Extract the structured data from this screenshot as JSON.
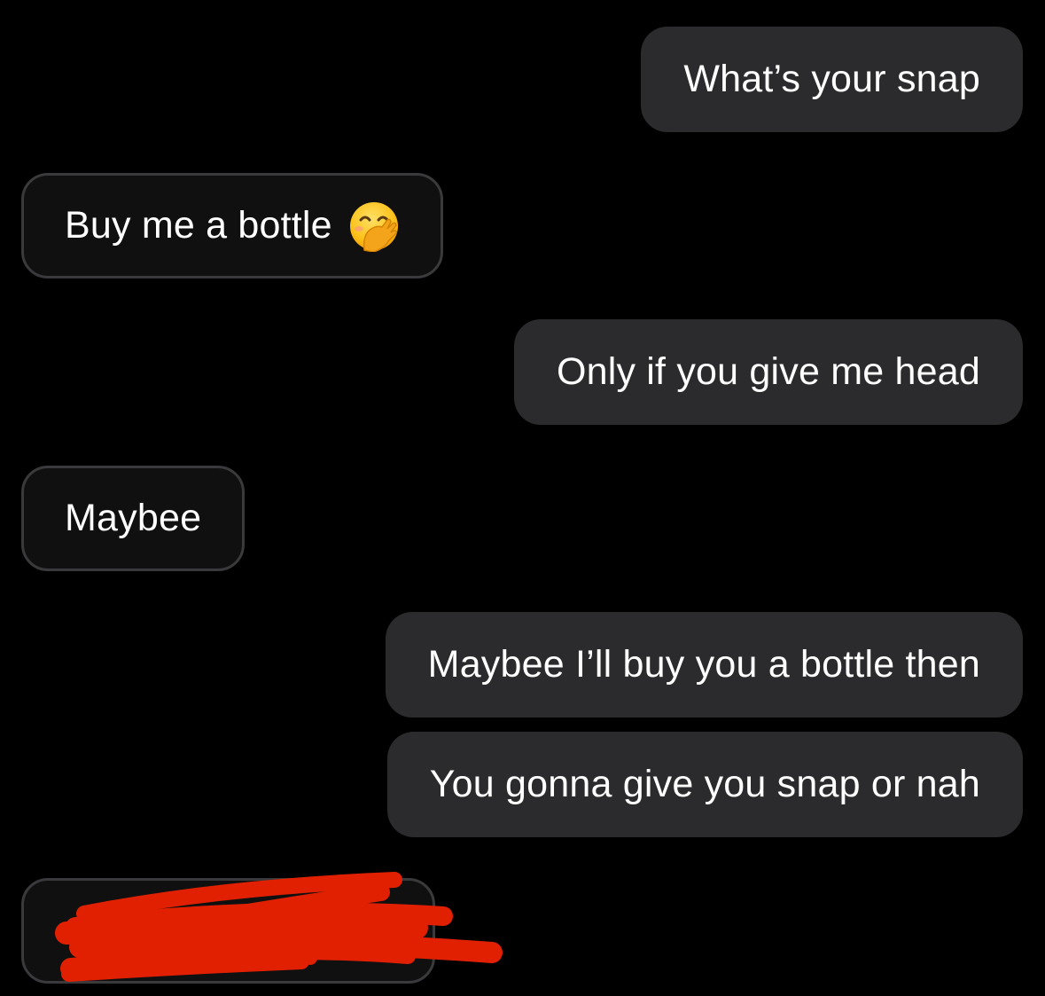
{
  "messages": [
    {
      "direction": "outgoing",
      "text": "What’s your snap"
    },
    {
      "direction": "incoming",
      "text": "Buy me a bottle",
      "emoji": "face-with-hand-over-mouth"
    },
    {
      "direction": "outgoing",
      "text": "Only if you give me head"
    },
    {
      "direction": "incoming",
      "text": "Maybee"
    },
    {
      "direction": "outgoing",
      "text": "Maybee I’ll buy you a bottle then"
    },
    {
      "direction": "outgoing",
      "text": "You gonna give you snap or nah"
    },
    {
      "direction": "incoming",
      "text": "",
      "redacted": true,
      "redaction_color": "#e02000"
    }
  ],
  "colors": {
    "background": "#000000",
    "outgoing_bubble": "#2b2b2d",
    "incoming_bubble": "#101010",
    "incoming_border": "#3a3a3c",
    "text": "#ffffff"
  }
}
